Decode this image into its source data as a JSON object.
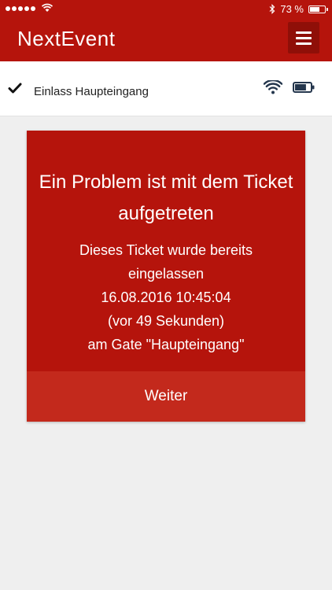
{
  "status_bar": {
    "battery_percent_label": "73 %",
    "battery_level": 0.73
  },
  "header": {
    "logo_text": "NextEvent",
    "menu_icon": "hamburger-menu-icon"
  },
  "info_row": {
    "check_icon": "checkmark-icon",
    "entrance_label": "Einlass Haupteingang",
    "wifi_icon": "wifi-icon",
    "battery_icon": "battery-icon"
  },
  "error_card": {
    "title": "Ein Problem ist mit dem Ticket aufgetreten",
    "lines": [
      "Dieses Ticket wurde bereits",
      "eingelassen",
      "16.08.2016 10:45:04",
      "(vor 49 Sekunden)",
      "am Gate \"Haupteingang\""
    ],
    "continue_label": "Weiter"
  },
  "colors": {
    "brand_red": "#b5140c",
    "menu_button_dark_red": "#8f0f08",
    "continue_button_red": "#c3291c",
    "background_gray": "#efefef"
  }
}
